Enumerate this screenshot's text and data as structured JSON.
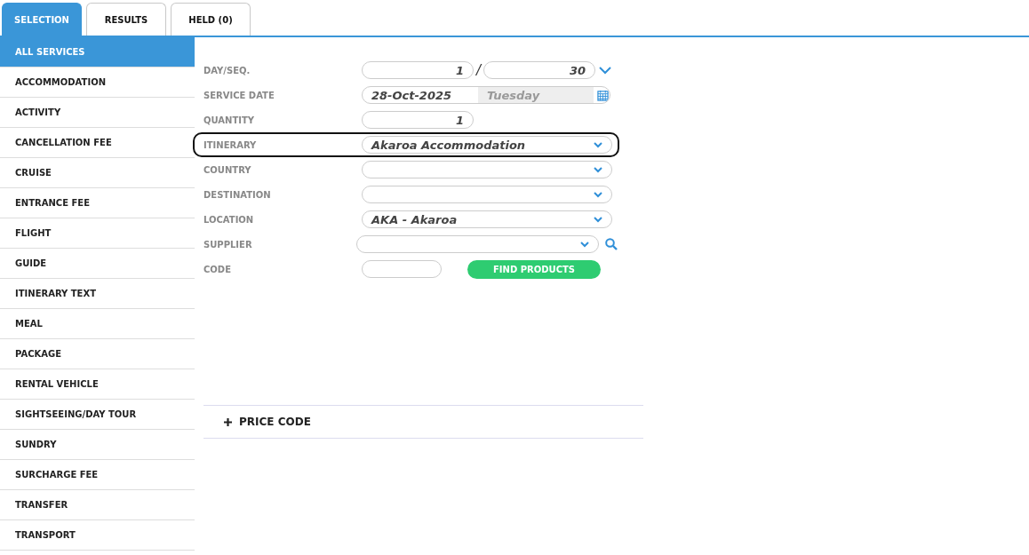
{
  "tabs": [
    {
      "label": "SELECTION",
      "selected": true
    },
    {
      "label": "RESULTS",
      "selected": false
    },
    {
      "label": "HELD (0)",
      "selected": false
    }
  ],
  "sidebar": {
    "items": [
      {
        "label": "ALL SERVICES",
        "selected": true
      },
      {
        "label": "ACCOMMODATION",
        "selected": false
      },
      {
        "label": "ACTIVITY",
        "selected": false
      },
      {
        "label": "CANCELLATION FEE",
        "selected": false
      },
      {
        "label": "CRUISE",
        "selected": false
      },
      {
        "label": "ENTRANCE FEE",
        "selected": false
      },
      {
        "label": "FLIGHT",
        "selected": false
      },
      {
        "label": "GUIDE",
        "selected": false
      },
      {
        "label": "ITINERARY TEXT",
        "selected": false
      },
      {
        "label": "MEAL",
        "selected": false
      },
      {
        "label": "PACKAGE",
        "selected": false
      },
      {
        "label": "RENTAL VEHICLE",
        "selected": false
      },
      {
        "label": "SIGHTSEEING/DAY TOUR",
        "selected": false
      },
      {
        "label": "SUNDRY",
        "selected": false
      },
      {
        "label": "SURCHARGE FEE",
        "selected": false
      },
      {
        "label": "TRANSFER",
        "selected": false
      },
      {
        "label": "TRANSPORT",
        "selected": false
      }
    ]
  },
  "form": {
    "fields": [
      {
        "kind": "pair",
        "label": "DAY/SEQ.",
        "value": "1",
        "separator": "/",
        "value_2": "30",
        "highlighted": false
      },
      {
        "kind": "date",
        "label": "SERVICE DATE",
        "value": "28-Oct-2025",
        "weekday": "Tuesday",
        "highlighted": false
      },
      {
        "kind": "number",
        "label": "QUANTITY",
        "value": "1",
        "highlighted": false
      },
      {
        "kind": "select",
        "label": "ITINERARY",
        "value": "Akaroa Accommodation",
        "highlighted": true
      },
      {
        "kind": "select",
        "label": "COUNTRY",
        "highlighted": false
      },
      {
        "kind": "select",
        "label": "DESTINATION",
        "highlighted": false
      },
      {
        "kind": "select",
        "label": "LOCATION",
        "value": "AKA - Akaroa",
        "highlighted": false
      },
      {
        "kind": "lookup",
        "label": "SUPPLIER",
        "highlighted": false
      },
      {
        "kind": "code",
        "label": "CODE",
        "button": "FIND PRODUCTS",
        "highlighted": false
      }
    ]
  },
  "price_code": {
    "label": "PRICE CODE",
    "expanded": false
  }
}
